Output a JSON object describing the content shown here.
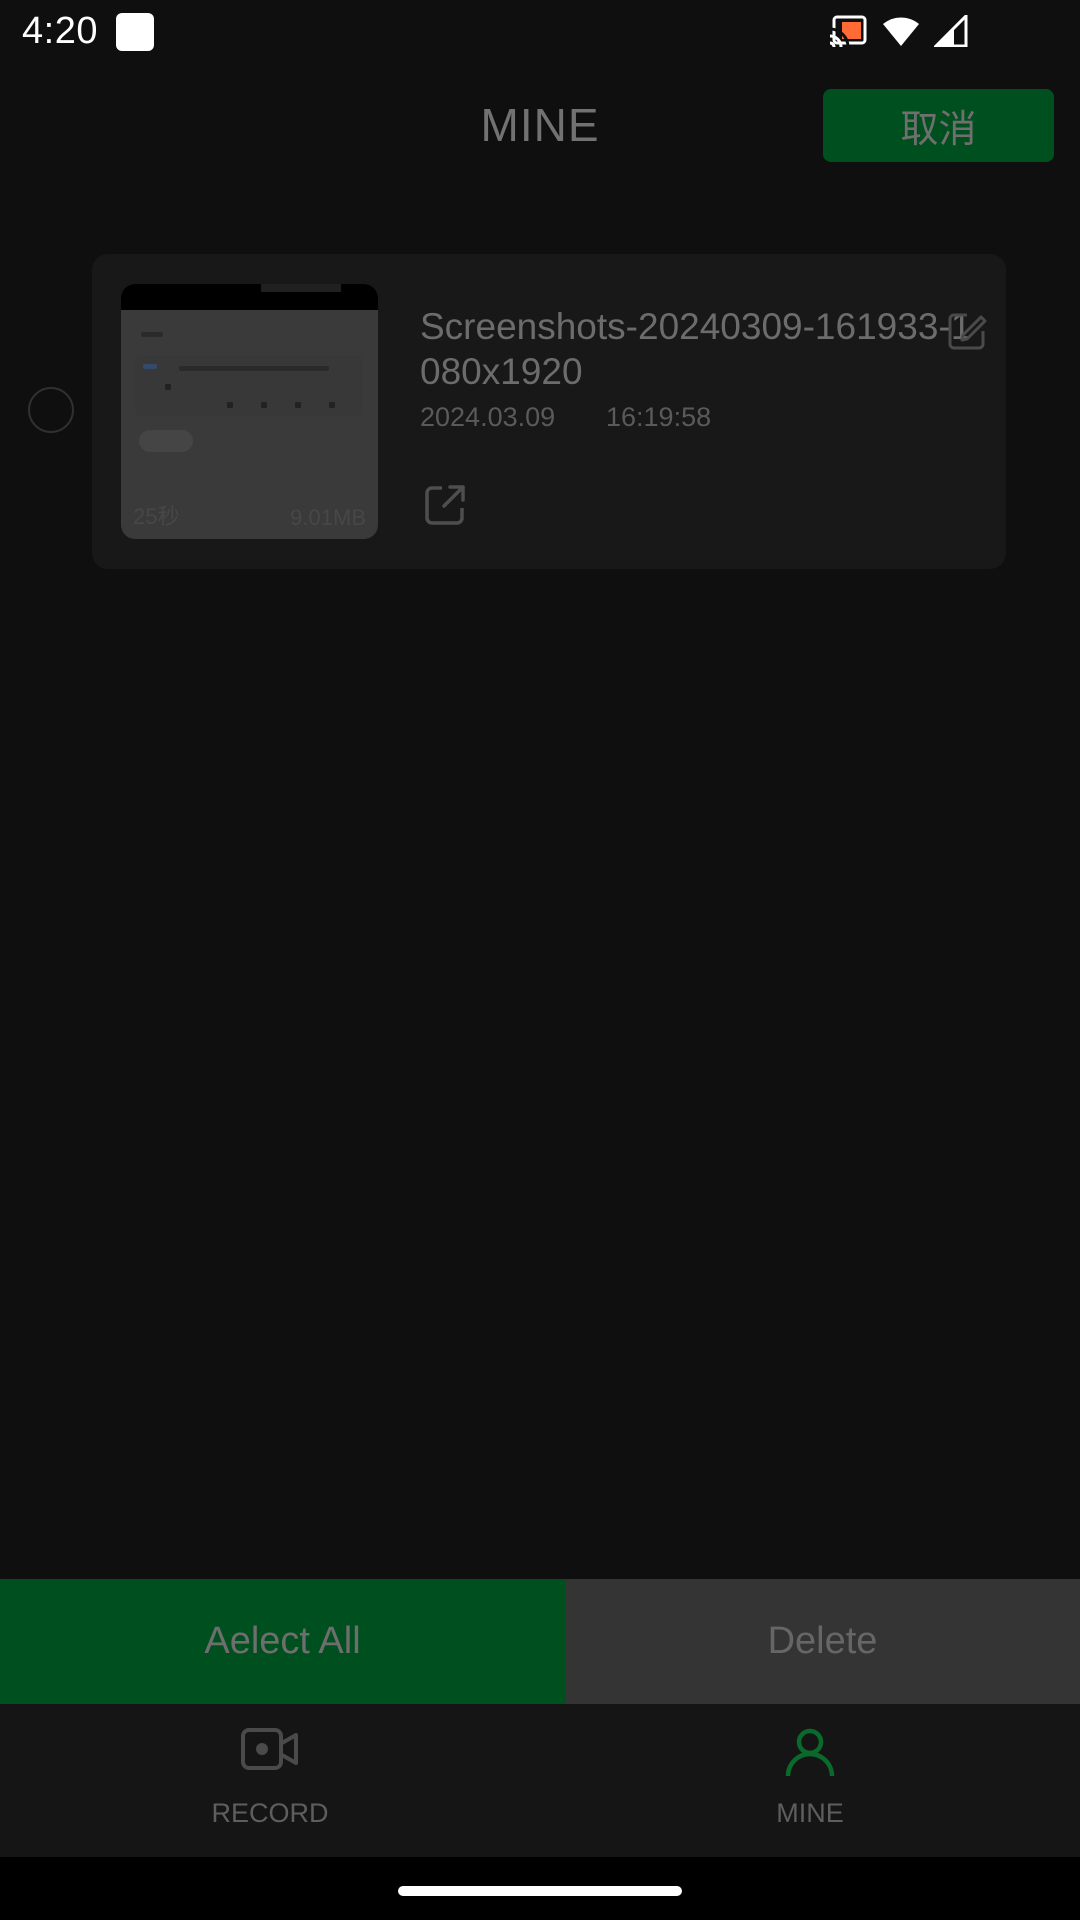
{
  "status_bar": {
    "time": "4:20",
    "icons": [
      "app-notification-icon",
      "cast-icon",
      "wifi-icon",
      "cell-signal-icon"
    ]
  },
  "header": {
    "title": "MINE",
    "cancel_label": "取消"
  },
  "recordings": [
    {
      "name": "Screenshots-20240309-161933-1080x1920",
      "date": "2024.03.09",
      "time": "16:19:58",
      "duration": "25秒",
      "size": "9.01MB",
      "selected": false
    }
  ],
  "actions": {
    "select_all_label": "Aelect All",
    "delete_label": "Delete"
  },
  "nav": {
    "items": [
      {
        "label": "RECORD",
        "icon": "video-camera-icon",
        "active": false
      },
      {
        "label": "MINE",
        "icon": "person-icon",
        "active": true
      }
    ]
  },
  "colors": {
    "background": "#0f0f0f",
    "accent_green": "#00501f",
    "active_icon": "#0a6a2b",
    "card": "#181818"
  }
}
